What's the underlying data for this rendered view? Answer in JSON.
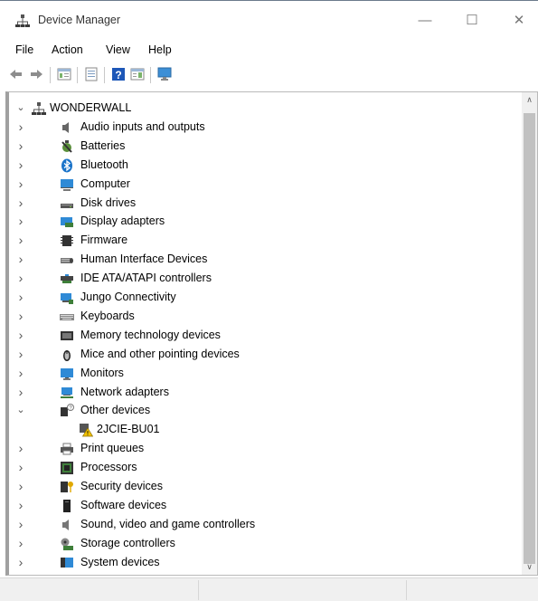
{
  "window": {
    "title": "Device Manager",
    "controls": {
      "minimize": "—",
      "maximize": "☐",
      "close": "✕"
    }
  },
  "menu": [
    "File",
    "Action",
    "View",
    "Help"
  ],
  "toolbar": {
    "buttons": [
      "back-icon",
      "forward-icon",
      "show-hide-console-tree-icon",
      "properties-icon",
      "help-icon",
      "action-pane-icon",
      "monitor-icon"
    ]
  },
  "tree": {
    "root": {
      "label": "WONDERWALL",
      "icon": "computer-network-icon",
      "expanded": true
    },
    "items": [
      {
        "label": "Audio inputs and outputs",
        "icon": "speaker-icon",
        "expanded": false
      },
      {
        "label": "Batteries",
        "icon": "battery-icon",
        "expanded": false
      },
      {
        "label": "Bluetooth",
        "icon": "bluetooth-icon",
        "expanded": false
      },
      {
        "label": "Computer",
        "icon": "computer-icon",
        "expanded": false
      },
      {
        "label": "Disk drives",
        "icon": "disk-drive-icon",
        "expanded": false
      },
      {
        "label": "Display adapters",
        "icon": "display-adapter-icon",
        "expanded": false
      },
      {
        "label": "Firmware",
        "icon": "firmware-icon",
        "expanded": false
      },
      {
        "label": "Human Interface Devices",
        "icon": "hid-icon",
        "expanded": false
      },
      {
        "label": "IDE ATA/ATAPI controllers",
        "icon": "ide-controller-icon",
        "expanded": false
      },
      {
        "label": "Jungo Connectivity",
        "icon": "jungo-icon",
        "expanded": false
      },
      {
        "label": "Keyboards",
        "icon": "keyboard-icon",
        "expanded": false
      },
      {
        "label": "Memory technology devices",
        "icon": "memory-icon",
        "expanded": false
      },
      {
        "label": "Mice and other pointing devices",
        "icon": "mouse-icon",
        "expanded": false
      },
      {
        "label": "Monitors",
        "icon": "monitor-icon",
        "expanded": false
      },
      {
        "label": "Network adapters",
        "icon": "network-adapter-icon",
        "expanded": false
      },
      {
        "label": "Other devices",
        "icon": "unknown-device-icon",
        "expanded": true
      },
      {
        "label": "2JCIE-BU01",
        "icon": "warning-device-icon",
        "child": true
      },
      {
        "label": "Print queues",
        "icon": "printer-icon",
        "expanded": false
      },
      {
        "label": "Processors",
        "icon": "processor-icon",
        "expanded": false
      },
      {
        "label": "Security devices",
        "icon": "security-device-icon",
        "expanded": false
      },
      {
        "label": "Software devices",
        "icon": "software-device-icon",
        "expanded": false
      },
      {
        "label": "Sound, video and game controllers",
        "icon": "sound-controller-icon",
        "expanded": false
      },
      {
        "label": "Storage controllers",
        "icon": "storage-controller-icon",
        "expanded": false
      },
      {
        "label": "System devices",
        "icon": "system-device-icon",
        "expanded": false
      }
    ]
  },
  "colors": {
    "accent": "#1a73c9",
    "warning": "#f2c200",
    "chevron": "#555555"
  }
}
